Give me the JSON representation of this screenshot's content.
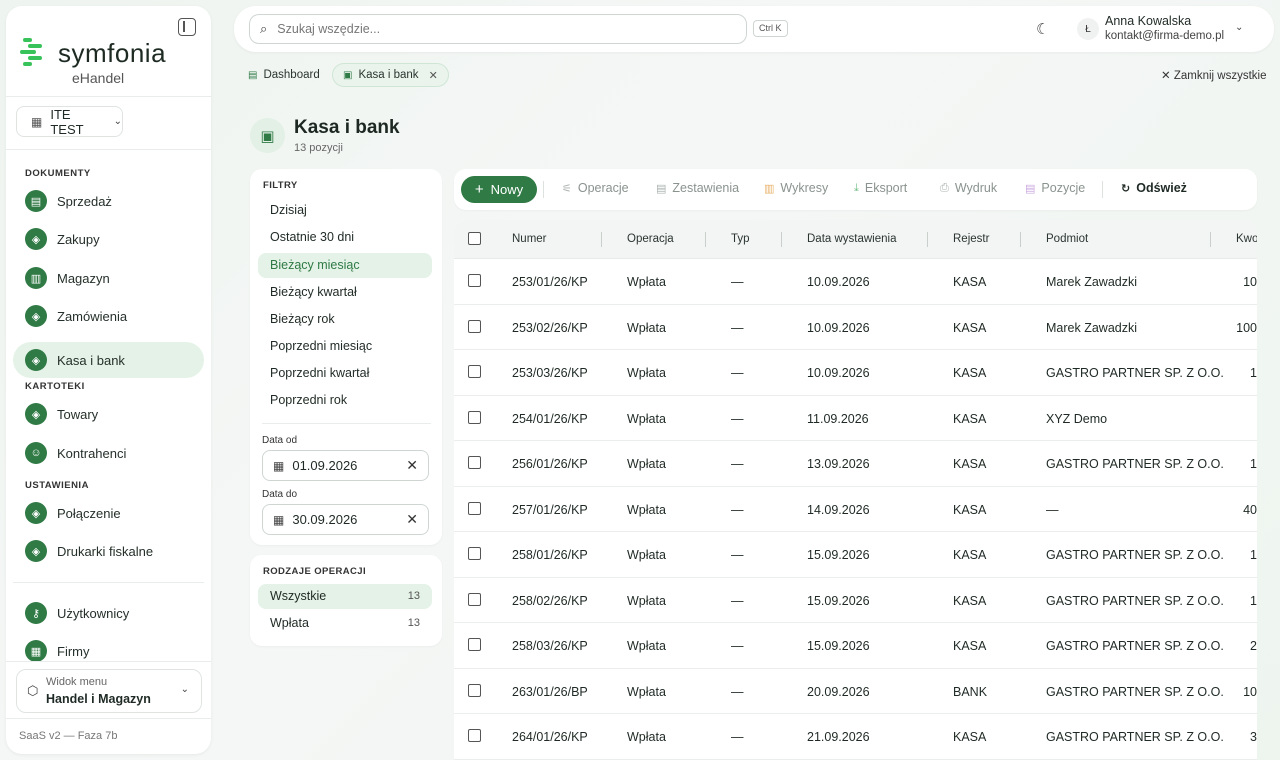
{
  "app": {
    "brand": "symfonia",
    "product": "eHandel",
    "version": "SaaS v2 — Faza 7b"
  },
  "company_selector": {
    "label": "ITE TEST"
  },
  "sidebar": {
    "sections": [
      {
        "label": "DOKUMENTY"
      },
      {
        "label": "KARTOTEKI"
      },
      {
        "label": "USTAWIENIA"
      }
    ],
    "items": [
      {
        "label": "Sprzedaż",
        "icon": "document-icon"
      },
      {
        "label": "Zakupy",
        "icon": "box-icon"
      },
      {
        "label": "Magazyn",
        "icon": "warehouse-icon"
      },
      {
        "label": "Zamówienia",
        "icon": "box-icon"
      },
      {
        "label": "Kasa i bank",
        "icon": "box-icon",
        "active": true
      },
      {
        "label": "Towary",
        "icon": "box-icon"
      },
      {
        "label": "Kontrahenci",
        "icon": "users-icon"
      },
      {
        "label": "Połączenie",
        "icon": "box-icon"
      },
      {
        "label": "Drukarki fiskalne",
        "icon": "box-icon"
      },
      {
        "label": "Użytkownicy",
        "icon": "user-key-icon"
      },
      {
        "label": "Firmy",
        "icon": "building-icon"
      }
    ],
    "menu_view": {
      "label": "Widok menu",
      "value": "Handel i Magazyn"
    }
  },
  "topbar": {
    "search_placeholder": "Szukaj wszędzie...",
    "shortcut": "Ctrl K",
    "user": {
      "initial": "Ł",
      "name": "Anna Kowalska",
      "email": "kontakt@firma-demo.pl"
    }
  },
  "tabs": [
    {
      "label": "Dashboard"
    },
    {
      "label": "Kasa i bank",
      "active": true
    }
  ],
  "close_all_label": "Zamknij wszystkie",
  "page": {
    "title": "Kasa i bank",
    "subtitle": "13 pozycji"
  },
  "filters": {
    "label": "FILTRY",
    "items": [
      "Dzisiaj",
      "Ostatnie 30 dni",
      "Bieżący miesiąc",
      "Bieżący kwartał",
      "Bieżący rok",
      "Poprzedni miesiąc",
      "Poprzedni kwartał",
      "Poprzedni rok"
    ],
    "active_index": 2,
    "date_from_label": "Data od",
    "date_from": "01.09.2026",
    "date_to_label": "Data do",
    "date_to": "30.09.2026"
  },
  "operation_kinds": {
    "label": "RODZAJE OPERACJI",
    "items": [
      {
        "label": "Wszystkie",
        "count": "13",
        "active": true
      },
      {
        "label": "Wpłata",
        "count": "13"
      }
    ]
  },
  "toolbar": {
    "new_label": "Nowy",
    "buttons": [
      "Operacje",
      "Zestawienia",
      "Wykresy",
      "Eksport",
      "Wydruk",
      "Pozycje"
    ],
    "refresh_label": "Odśwież"
  },
  "table": {
    "columns": [
      "Numer",
      "Operacja",
      "Typ",
      "Data wystawienia",
      "Rejestr",
      "Podmiot",
      "Kwo"
    ],
    "rows": [
      {
        "numer": "253/01/26/KP",
        "operacja": "Wpłata",
        "typ": "—",
        "data": "10.09.2026",
        "rejestr": "KASA",
        "podmiot": "Marek Zawadzki",
        "kwota": "10"
      },
      {
        "numer": "253/02/26/KP",
        "operacja": "Wpłata",
        "typ": "—",
        "data": "10.09.2026",
        "rejestr": "KASA",
        "podmiot": "Marek Zawadzki",
        "kwota": "100"
      },
      {
        "numer": "253/03/26/KP",
        "operacja": "Wpłata",
        "typ": "—",
        "data": "10.09.2026",
        "rejestr": "KASA",
        "podmiot": "GASTRO PARTNER SP. Z O.O.",
        "kwota": "1"
      },
      {
        "numer": "254/01/26/KP",
        "operacja": "Wpłata",
        "typ": "—",
        "data": "11.09.2026",
        "rejestr": "KASA",
        "podmiot": "XYZ Demo",
        "kwota": ""
      },
      {
        "numer": "256/01/26/KP",
        "operacja": "Wpłata",
        "typ": "—",
        "data": "13.09.2026",
        "rejestr": "KASA",
        "podmiot": "GASTRO PARTNER SP. Z O.O.",
        "kwota": "1"
      },
      {
        "numer": "257/01/26/KP",
        "operacja": "Wpłata",
        "typ": "—",
        "data": "14.09.2026",
        "rejestr": "KASA",
        "podmiot": "—",
        "kwota": "40"
      },
      {
        "numer": "258/01/26/KP",
        "operacja": "Wpłata",
        "typ": "—",
        "data": "15.09.2026",
        "rejestr": "KASA",
        "podmiot": "GASTRO PARTNER SP. Z O.O.",
        "kwota": "1"
      },
      {
        "numer": "258/02/26/KP",
        "operacja": "Wpłata",
        "typ": "—",
        "data": "15.09.2026",
        "rejestr": "KASA",
        "podmiot": "GASTRO PARTNER SP. Z O.O.",
        "kwota": "1"
      },
      {
        "numer": "258/03/26/KP",
        "operacja": "Wpłata",
        "typ": "—",
        "data": "15.09.2026",
        "rejestr": "KASA",
        "podmiot": "GASTRO PARTNER SP. Z O.O.",
        "kwota": "2"
      },
      {
        "numer": "263/01/26/BP",
        "operacja": "Wpłata",
        "typ": "—",
        "data": "20.09.2026",
        "rejestr": "BANK",
        "podmiot": "GASTRO PARTNER SP. Z O.O.",
        "kwota": "10"
      },
      {
        "numer": "264/01/26/KP",
        "operacja": "Wpłata",
        "typ": "—",
        "data": "21.09.2026",
        "rejestr": "KASA",
        "podmiot": "GASTRO PARTNER SP. Z O.O.",
        "kwota": "3"
      }
    ]
  },
  "colors": {
    "accent": "#2f7a45",
    "accent_light": "#e4f2e7"
  }
}
